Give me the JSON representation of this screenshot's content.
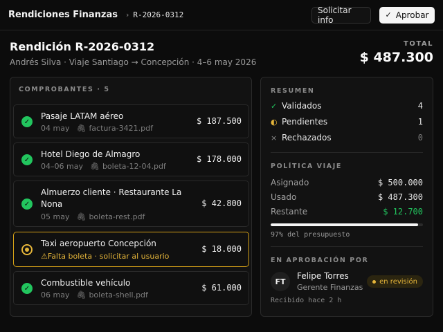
{
  "topbar": {
    "app_title": "Rendiciones Finanzas",
    "separator": "›",
    "report_id": "R-2026-0312",
    "request_info_label": "Solicitar info",
    "approve_label": "Aprobar"
  },
  "header": {
    "title": "Rendición R-2026-0312",
    "subtitle": "Andrés Silva · Viaje Santiago → Concepción · 4–6 may 2026",
    "total_label": "TOTAL",
    "total_value": "$ 487.300"
  },
  "receipts": {
    "section_label": "COMPROBANTES · 5",
    "items": [
      {
        "name": "Pasaje LATAM aéreo",
        "date": "04 may",
        "file": "factura-3421.pdf",
        "amount": "$ 187.500",
        "status": "ok"
      },
      {
        "name": "Hotel Diego de Almagro",
        "date": "04–06 may",
        "file": "boleta-12-04.pdf",
        "amount": "$ 178.000",
        "status": "ok"
      },
      {
        "name": "Almuerzo cliente · Restaurante La Nona",
        "date": "05 may",
        "file": "boleta-rest.pdf",
        "amount": "$ 42.800",
        "status": "ok"
      },
      {
        "name": "Taxi aeropuerto Concepción",
        "warning": "Falta boleta · solicitar al usuario",
        "amount": "$ 18.000",
        "status": "pending"
      },
      {
        "name": "Combustible vehículo",
        "date": "06 may",
        "file": "boleta-shell.pdf",
        "amount": "$ 61.000",
        "status": "ok"
      }
    ]
  },
  "summary": {
    "section_label": "RESUMEN",
    "validated_label": "Validados",
    "validated_count": "4",
    "pending_label": "Pendientes",
    "pending_count": "1",
    "rejected_label": "Rechazados",
    "rejected_count": "0"
  },
  "policy": {
    "section_label": "POLÍTICA VIAJE",
    "assigned_label": "Asignado",
    "assigned_value": "$ 500.000",
    "used_label": "Usado",
    "used_value": "$ 487.300",
    "remaining_label": "Restante",
    "remaining_value": "$ 12.700",
    "budget_used_fraction": 0.97,
    "budget_caption": "97% del presupuesto"
  },
  "approval": {
    "section_label": "EN APROBACIÓN POR",
    "initials": "FT",
    "name": "Felipe Torres",
    "role": "Gerente Finanzas",
    "status_badge": "en revisión",
    "received": "Recibido hace 2 h"
  },
  "colors": {
    "success": "#22c55e",
    "warning": "#e5b53a",
    "background": "#0c0c0c",
    "panel": "#121212"
  }
}
